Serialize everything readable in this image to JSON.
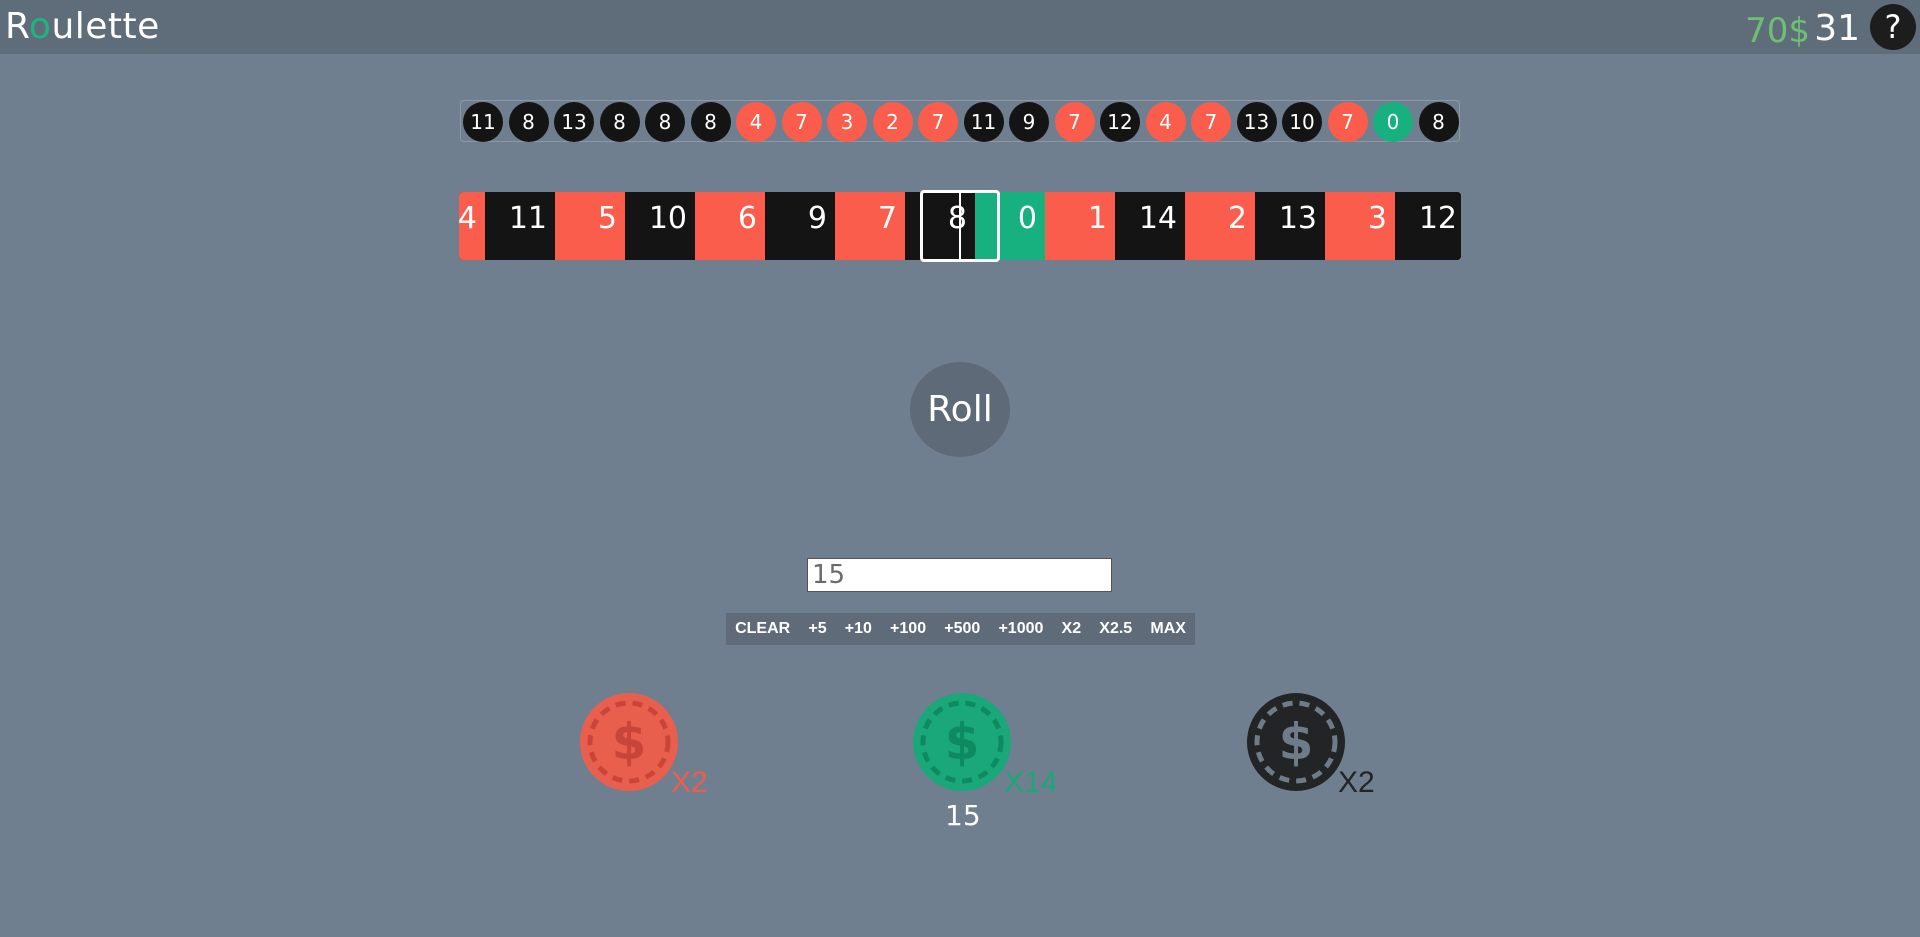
{
  "header": {
    "title_prefix": "R",
    "title_accent": "o",
    "title_suffix": "ulette",
    "balance": "70$",
    "level": "31",
    "help_label": "?"
  },
  "colors": {
    "red": "#fa5d4b",
    "black": "#141414",
    "green": "#16b17e",
    "balance_green": "#6fbf73"
  },
  "history": [
    {
      "n": "11",
      "c": "black"
    },
    {
      "n": "8",
      "c": "black"
    },
    {
      "n": "13",
      "c": "black"
    },
    {
      "n": "8",
      "c": "black"
    },
    {
      "n": "8",
      "c": "black"
    },
    {
      "n": "8",
      "c": "black"
    },
    {
      "n": "4",
      "c": "red"
    },
    {
      "n": "7",
      "c": "red"
    },
    {
      "n": "3",
      "c": "red"
    },
    {
      "n": "2",
      "c": "red"
    },
    {
      "n": "7",
      "c": "red"
    },
    {
      "n": "11",
      "c": "black"
    },
    {
      "n": "9",
      "c": "black"
    },
    {
      "n": "7",
      "c": "red"
    },
    {
      "n": "12",
      "c": "black"
    },
    {
      "n": "4",
      "c": "red"
    },
    {
      "n": "7",
      "c": "red"
    },
    {
      "n": "13",
      "c": "black"
    },
    {
      "n": "10",
      "c": "black"
    },
    {
      "n": "7",
      "c": "red"
    },
    {
      "n": "0",
      "c": "green"
    },
    {
      "n": "8",
      "c": "black"
    }
  ],
  "strip": [
    {
      "n": "4",
      "c": "red"
    },
    {
      "n": "11",
      "c": "black"
    },
    {
      "n": "5",
      "c": "red"
    },
    {
      "n": "10",
      "c": "black"
    },
    {
      "n": "6",
      "c": "red"
    },
    {
      "n": "9",
      "c": "black"
    },
    {
      "n": "7",
      "c": "red"
    },
    {
      "n": "8",
      "c": "black"
    },
    {
      "n": "0",
      "c": "green"
    },
    {
      "n": "1",
      "c": "red"
    },
    {
      "n": "14",
      "c": "black"
    },
    {
      "n": "2",
      "c": "red"
    },
    {
      "n": "13",
      "c": "black"
    },
    {
      "n": "3",
      "c": "red"
    },
    {
      "n": "12",
      "c": "black"
    }
  ],
  "roll_label": "Roll",
  "bet_input": {
    "value": "15"
  },
  "bet_controls": [
    "CLEAR",
    "+5",
    "+10",
    "+100",
    "+500",
    "+1000",
    "X2",
    "X2.5",
    "MAX"
  ],
  "bets": [
    {
      "name": "red",
      "multiplier": "X2",
      "amount": ""
    },
    {
      "name": "green",
      "multiplier": "X14",
      "amount": "15"
    },
    {
      "name": "black",
      "multiplier": "X2",
      "amount": ""
    }
  ],
  "icons": {
    "chip": "dollar-chip-icon",
    "help": "question-icon"
  }
}
